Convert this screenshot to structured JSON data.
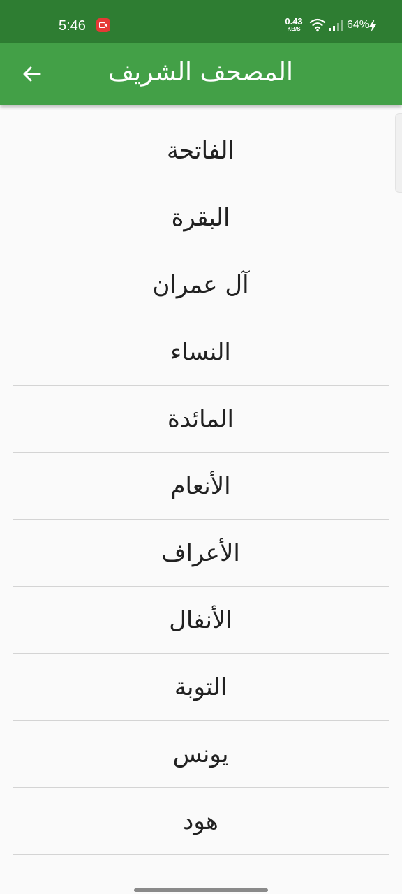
{
  "status_bar": {
    "time": "5:46",
    "net_speed_value": "0.43",
    "net_speed_unit": "KB/S",
    "battery": "64%",
    "icons": [
      "screen-record-icon",
      "wifi-icon",
      "signal-icon",
      "charging-bolt-icon"
    ]
  },
  "app_bar": {
    "title": "المصحف  الشريف",
    "back_icon": "arrow-back-icon"
  },
  "surahs": [
    "الفاتحة",
    "البقرة",
    "آل  عمران",
    "النساء",
    "المائدة",
    "الأنعام",
    "الأعراف",
    "الأنفال",
    "التوبة",
    "يونس",
    "هود"
  ],
  "colors": {
    "status_bar": "#2e7d32",
    "app_bar": "#43a047",
    "background": "#fafafa",
    "divider": "#d4d4d4",
    "record_badge": "#e53935"
  }
}
